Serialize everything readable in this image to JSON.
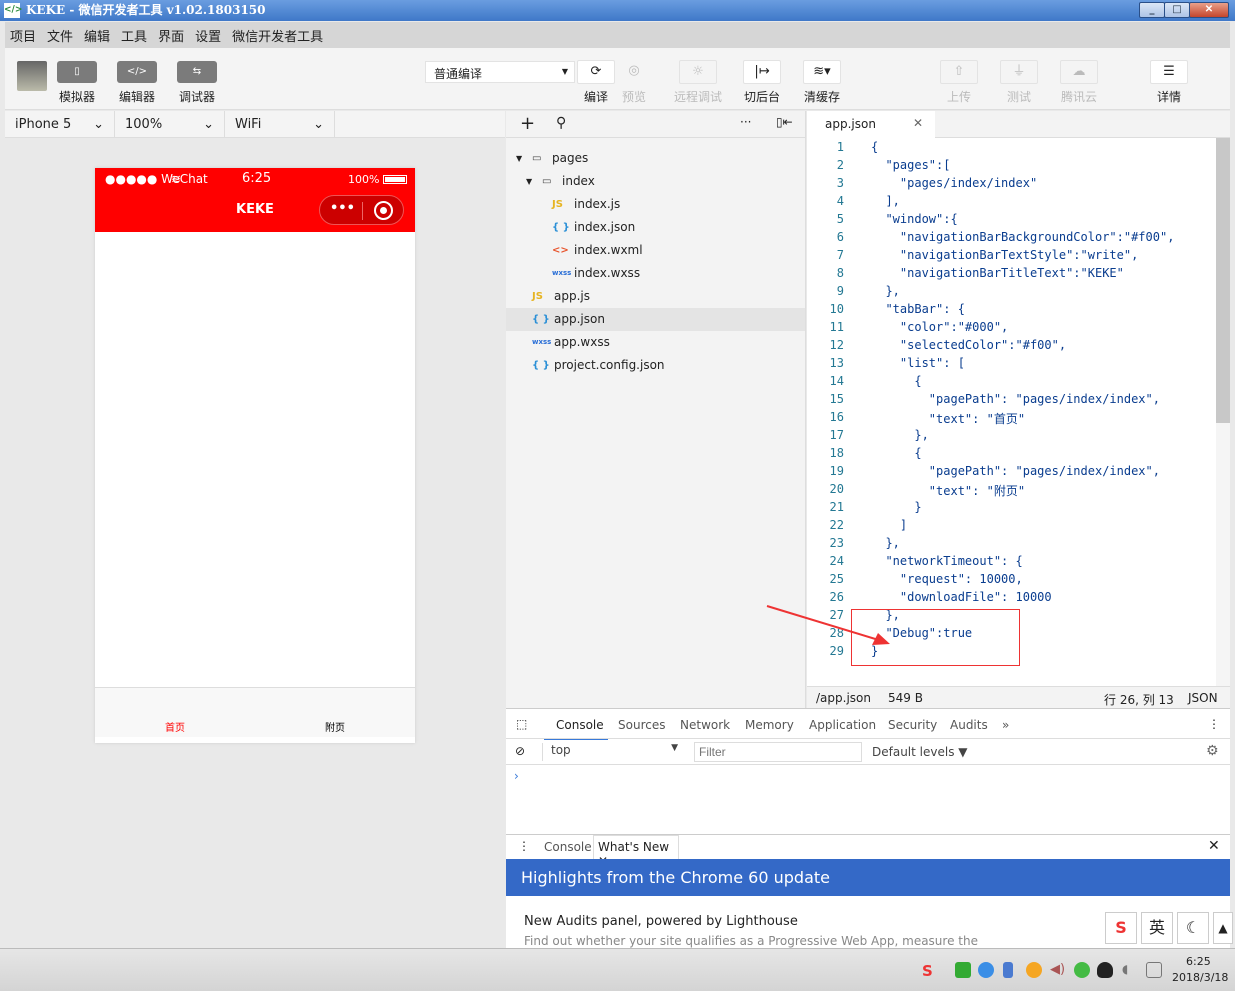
{
  "window": {
    "title": "KEKE - 微信开发者工具 v1.02.1803150",
    "controls": [
      "_",
      "□",
      "✕"
    ]
  },
  "menu": [
    "项目",
    "文件",
    "编辑",
    "工具",
    "界面",
    "设置",
    "微信开发者工具"
  ],
  "toolbar": {
    "modes": [
      {
        "label": "模拟器",
        "icon": "phone-icon"
      },
      {
        "label": "编辑器",
        "icon": "code-icon"
      },
      {
        "label": "调试器",
        "icon": "debug-icon"
      }
    ],
    "compile_mode": "普通编译",
    "actions": [
      {
        "label": "编译",
        "icon": "refresh-icon",
        "enabled": true
      },
      {
        "label": "预览",
        "icon": "eye-icon",
        "enabled": false
      },
      {
        "label": "远程调试",
        "icon": "bug-icon",
        "enabled": false
      },
      {
        "label": "切后台",
        "icon": "switch-background-icon",
        "enabled": true
      },
      {
        "label": "清缓存",
        "icon": "layers-icon",
        "enabled": true
      },
      {
        "label": "上传",
        "icon": "upload-icon",
        "enabled": false
      },
      {
        "label": "测试",
        "icon": "flask-icon",
        "enabled": false
      },
      {
        "label": "腾讯云",
        "icon": "cloud-icon",
        "enabled": false
      },
      {
        "label": "详情",
        "icon": "menu-icon",
        "enabled": true
      }
    ]
  },
  "device": {
    "model": "iPhone 5",
    "zoom": "100%",
    "network": "WiFi"
  },
  "phone": {
    "carrier": "●●●●● WeChat",
    "time": "6:25",
    "battery": "100%",
    "nav_title": "KEKE",
    "nav_color": "#ff0000",
    "tabs": [
      {
        "label": "首页",
        "active": true
      },
      {
        "label": "附页",
        "active": false
      }
    ]
  },
  "filetree": {
    "items": [
      {
        "name": "pages",
        "type": "folder",
        "depth": 0
      },
      {
        "name": "index",
        "type": "folder",
        "depth": 1
      },
      {
        "name": "index.js",
        "type": "js",
        "depth": 2
      },
      {
        "name": "index.json",
        "type": "json",
        "depth": 2
      },
      {
        "name": "index.wxml",
        "type": "wxml",
        "depth": 2
      },
      {
        "name": "index.wxss",
        "type": "wxss",
        "depth": 2
      },
      {
        "name": "app.js",
        "type": "js",
        "depth": 0
      },
      {
        "name": "app.json",
        "type": "json",
        "depth": 0,
        "selected": true
      },
      {
        "name": "app.wxss",
        "type": "wxss",
        "depth": 0
      },
      {
        "name": "project.config.json",
        "type": "json",
        "depth": 0
      }
    ]
  },
  "editor": {
    "tab": "app.json",
    "lines": [
      "{",
      "  \"pages\":[",
      "    \"pages/index/index\"",
      "  ],",
      "  \"window\":{",
      "    \"navigationBarBackgroundColor\":\"#f00\",",
      "    \"navigationBarTextStyle\":\"write\",",
      "    \"navigationBarTitleText\":\"KEKE\"",
      "  },",
      "  \"tabBar\": {",
      "    \"color\":\"#000\",",
      "    \"selectedColor\":\"#f00\",",
      "    \"list\": [",
      "      {",
      "        \"pagePath\": \"pages/index/index\",",
      "        \"text\": \"首页\"",
      "      },",
      "      {",
      "        \"pagePath\": \"pages/index/index\",",
      "        \"text\": \"附页\"",
      "      }",
      "    ]",
      "  },",
      "  \"networkTimeout\": {",
      "    \"request\": 10000,",
      "    \"downloadFile\": 10000",
      "  },",
      "  \"Debug\":true",
      "}"
    ]
  },
  "statusbar": {
    "path": "/app.json",
    "size": "549 B",
    "position": "行 26, 列 13",
    "language": "JSON"
  },
  "devtools": {
    "tabs": [
      "Console",
      "Sources",
      "Network",
      "Memory",
      "Application",
      "Security",
      "Audits",
      "»"
    ],
    "context": "top",
    "filter_placeholder": "Filter",
    "levels": "Default levels ▼",
    "prompt": "›"
  },
  "drawer": {
    "tabs": [
      "Console",
      "What's New"
    ],
    "banner": "Highlights from the Chrome 60 update",
    "headline": "New Audits panel, powered by Lighthouse",
    "body": "Find out whether your site qualifies as a Progressive Web App, measure the"
  },
  "ime": {
    "mode": "英"
  },
  "taskbar": {
    "time": "6:25",
    "date": "2018/3/18"
  }
}
